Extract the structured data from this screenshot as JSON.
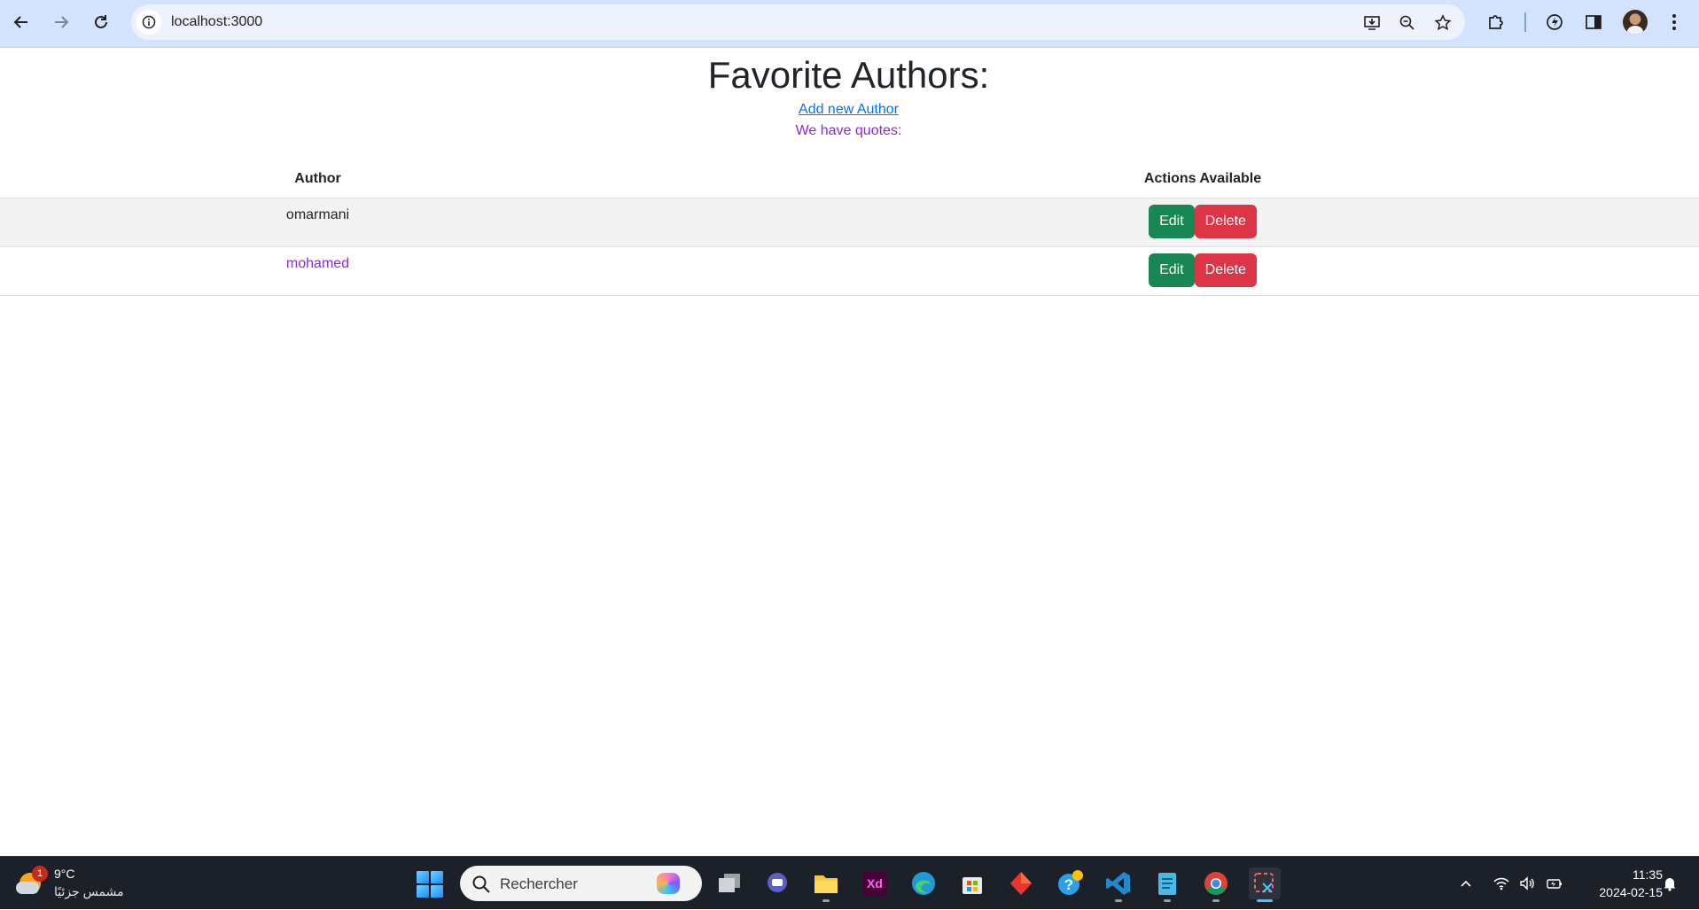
{
  "browser": {
    "url": "localhost:3000",
    "icons": {
      "back": "back-arrow-icon",
      "forward": "forward-arrow-icon",
      "reload": "reload-icon",
      "site_info": "info-icon",
      "install": "install-app-icon",
      "zoom": "zoom-icon",
      "bookmark": "star-icon",
      "extensions": "puzzle-icon",
      "performance": "speed-icon",
      "side_panel": "side-panel-icon",
      "profile": "avatar",
      "menu": "kebab-menu-icon"
    }
  },
  "page": {
    "title": "Favorite Authors:",
    "add_link": "Add new Author",
    "quotes_text": "We have quotes:",
    "table": {
      "headers": [
        "Author",
        "Actions Available"
      ],
      "rows": [
        {
          "author": "omarmani",
          "edit_label": "Edit",
          "delete_label": "Delete"
        },
        {
          "author": "mohamed",
          "edit_label": "Edit",
          "delete_label": "Delete"
        }
      ]
    }
  },
  "colors": {
    "chrome_bg": "#d3e3fd",
    "link": "#0d6efd",
    "purple_text": "#8a2be2",
    "edit_button": "#198754",
    "delete_button": "#dc3545",
    "taskbar_bg": "#1c2029"
  },
  "taskbar": {
    "weather": {
      "temp": "9°C",
      "condition": "مشمس جزئيًا",
      "badge": "1"
    },
    "search_placeholder": "Rechercher",
    "apps": [
      "windows-start-icon",
      "task-view-icon",
      "teams-icon",
      "file-explorer-icon",
      "adobe-xd-icon",
      "edge-icon",
      "store-icon",
      "app-diamond-icon",
      "help-icon",
      "vscode-icon",
      "notepad-icon",
      "chrome-icon",
      "snipping-tool-icon"
    ],
    "tray_icons": [
      "chevron-up-icon",
      "wifi-icon",
      "volume-icon",
      "battery-icon",
      "notification-bell-icon"
    ],
    "time": "11:35",
    "date": "2024-02-15"
  }
}
